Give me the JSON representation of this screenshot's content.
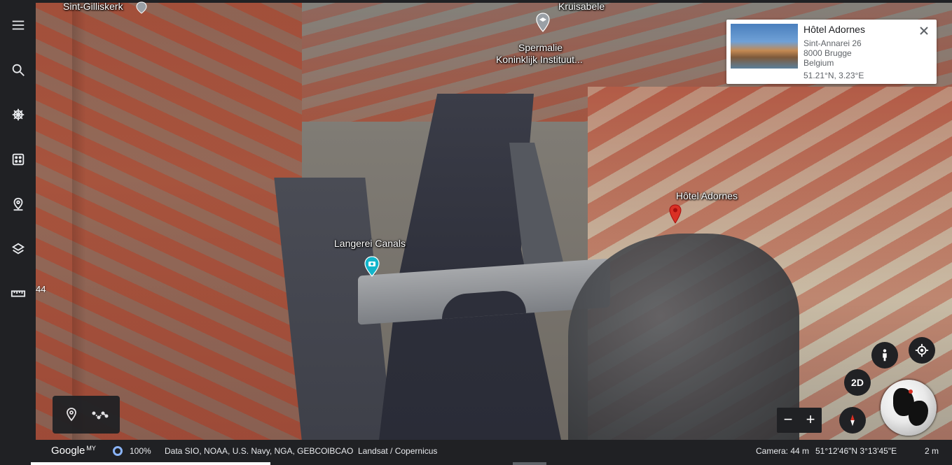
{
  "sidebar": {
    "items": [
      {
        "name": "menu-icon"
      },
      {
        "name": "search-icon"
      },
      {
        "name": "voyager-icon"
      },
      {
        "name": "feeling-lucky-icon"
      },
      {
        "name": "projects-icon"
      },
      {
        "name": "map-style-icon"
      },
      {
        "name": "measure-icon"
      }
    ]
  },
  "map": {
    "labels": {
      "sint_gilliskerk": "Sint-Gilliskerk",
      "kruisabele": "Kruisabele",
      "spermalie_line1": "Spermalie",
      "spermalie_line2": "Koninklijk Instituut...",
      "langerei": "Langerei Canals",
      "hotel": "Hôtel Adornes"
    },
    "edge_number": "44"
  },
  "card": {
    "title": "Hôtel Adornes",
    "address1": "Sint-Annarei 26",
    "address2": "8000 Brugge",
    "country": "Belgium",
    "coords": "51.21°N, 3.23°E"
  },
  "controls": {
    "toggle_2d": "2D",
    "zoom_out": "−",
    "zoom_in": "+"
  },
  "statusbar": {
    "logo": "Google",
    "logo_sup": "MY",
    "progress": "100%",
    "attribution1": "Data SIO, NOAA, U.S. Navy, NGA, GEBCO",
    "attribution2": "IBCAO",
    "attribution3": "Landsat / Copernicus",
    "camera": "Camera: 44 m",
    "coordinates": "51°12'46\"N 3°13'45\"E",
    "scale": "2 m"
  },
  "colors": {
    "toolbar_bg": "#202124",
    "pin_red": "#d93025",
    "poi_teal": "#12b5cb",
    "poi_gray": "#9aa0a6"
  }
}
